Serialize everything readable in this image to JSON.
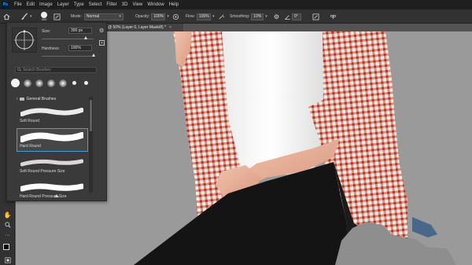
{
  "app": {
    "logo": "Ps"
  },
  "menu": [
    "File",
    "Edit",
    "Image",
    "Layer",
    "Type",
    "Select",
    "Filter",
    "3D",
    "View",
    "Window",
    "Help"
  ],
  "options": {
    "brush_size": "300",
    "mode_label": "Mode:",
    "mode_value": "Normal",
    "opacity_label": "Opacity:",
    "opacity_value": "100%",
    "flow_label": "Flow:",
    "flow_value": "100%",
    "smoothing_label": "Smoothing:",
    "smoothing_value": "10%",
    "angle_value": "0°"
  },
  "document_tab": {
    "title": "@ 50% (Layer 0, Layer Mask/8) *",
    "close": "×"
  },
  "brush_panel": {
    "size_label": "Size:",
    "size_value": "300 px",
    "hardness_label": "Hardness:",
    "hardness_value": "100%",
    "size_fraction": 0.85,
    "hardness_fraction": 1.0,
    "search_placeholder": "Search Brushes",
    "tips": [
      {
        "label": ""
      },
      {
        "label": ""
      },
      {
        "label": ""
      },
      {
        "label": ""
      },
      {
        "label": ""
      },
      {
        "label": ""
      },
      {
        "label": ""
      }
    ],
    "folder_name": "General Brushes",
    "brushes": [
      {
        "name": "Soft Round",
        "selected": false
      },
      {
        "name": "Hard Round",
        "selected": true
      },
      {
        "name": "Soft Round Pressure Size",
        "selected": false
      },
      {
        "name": "Hard Round Pressure Size",
        "selected": false
      }
    ]
  },
  "colors": {
    "shirt_white": "#f2f2f2",
    "check_red": "#c9452f",
    "leggings": "#141414",
    "canvas_gray": "#9a9a9a",
    "skin": "#e8b39e",
    "selection_blue": "#3f9fd6"
  }
}
